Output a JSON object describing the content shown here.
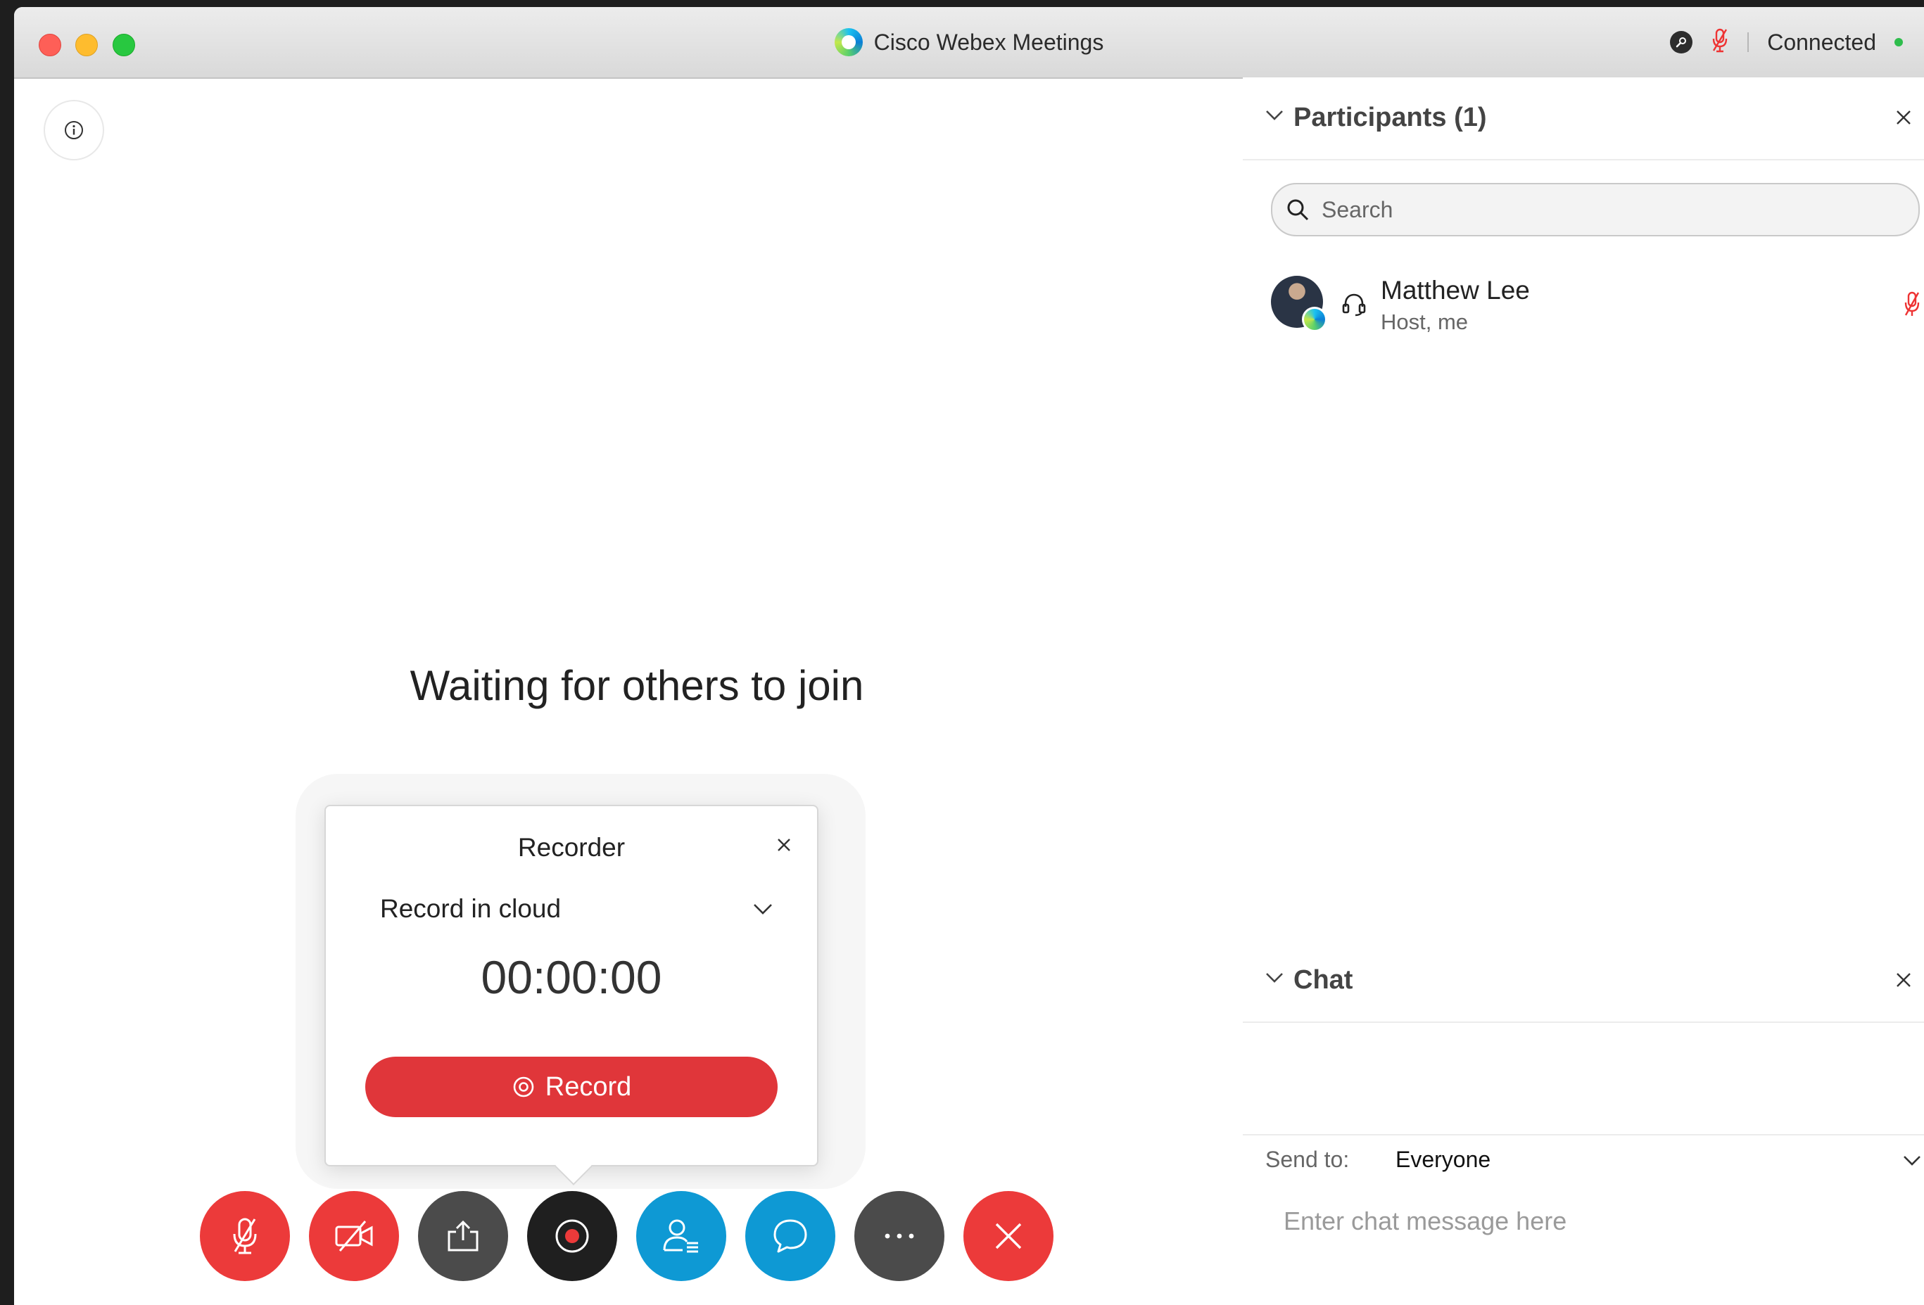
{
  "window": {
    "title": "Cisco Webex Meetings",
    "status": "Connected",
    "status_color": "#2ebd4c"
  },
  "stage": {
    "waiting_message": "Waiting for others to join"
  },
  "recorder": {
    "title": "Recorder",
    "mode": "Record in cloud",
    "timer": "00:00:00",
    "record_label": "Record",
    "record_color": "#e0363a"
  },
  "controls": [
    {
      "name": "mute-button",
      "icon": "muted-mic-icon",
      "color": "#ec3a3a"
    },
    {
      "name": "video-button",
      "icon": "video-off-icon",
      "color": "#ec3a3a"
    },
    {
      "name": "share-button",
      "icon": "share-icon",
      "color": "#4b4b4b"
    },
    {
      "name": "record-button",
      "icon": "record-icon",
      "color": "#1f1f1f"
    },
    {
      "name": "participants-button",
      "icon": "participants-icon",
      "color": "#0e99d4"
    },
    {
      "name": "chat-button",
      "icon": "chat-icon",
      "color": "#0e99d4"
    },
    {
      "name": "more-button",
      "icon": "more-icon",
      "color": "#4b4b4b"
    },
    {
      "name": "leave-button",
      "icon": "close-icon",
      "color": "#ec3a3a"
    }
  ],
  "participants_panel": {
    "title": "Participants (1)",
    "search_placeholder": "Search",
    "participants": [
      {
        "name": "Matthew Lee",
        "role": "Host, me",
        "audio": "headset-icon",
        "mic": "muted-mic-icon"
      }
    ]
  },
  "chat_panel": {
    "title": "Chat",
    "send_to_label": "Send to:",
    "send_to_value": "Everyone",
    "input_placeholder": "Enter chat message here"
  }
}
